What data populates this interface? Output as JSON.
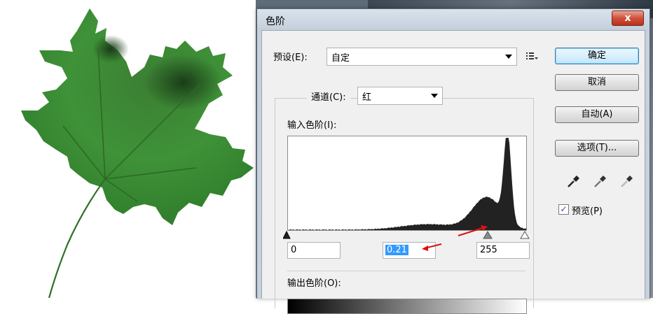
{
  "dialog": {
    "title": "色阶",
    "close_label": "x",
    "preset_label": "预设(E):",
    "preset_value": "自定",
    "channel_label": "通道(C):",
    "channel_value": "红",
    "input_levels_label": "输入色阶(I):",
    "input_black": "0",
    "input_gamma": "0.21",
    "input_white": "255",
    "output_levels_label": "输出色阶(O):",
    "buttons": {
      "ok": "确定",
      "cancel": "取消",
      "auto": "自动(A)",
      "options": "选项(T)..."
    },
    "preview_label": "预览(P)",
    "preview_checked": "✓",
    "preset_options_icon": "menu-list-icon",
    "histogram": {
      "peak_level": 235,
      "gamma_slider_level": 230
    }
  },
  "colors": {
    "leaf_dark": "#1f5a1a",
    "leaf_light": "#3f8f35",
    "annotation_red": "#e01010",
    "selection": "#3399ff"
  }
}
